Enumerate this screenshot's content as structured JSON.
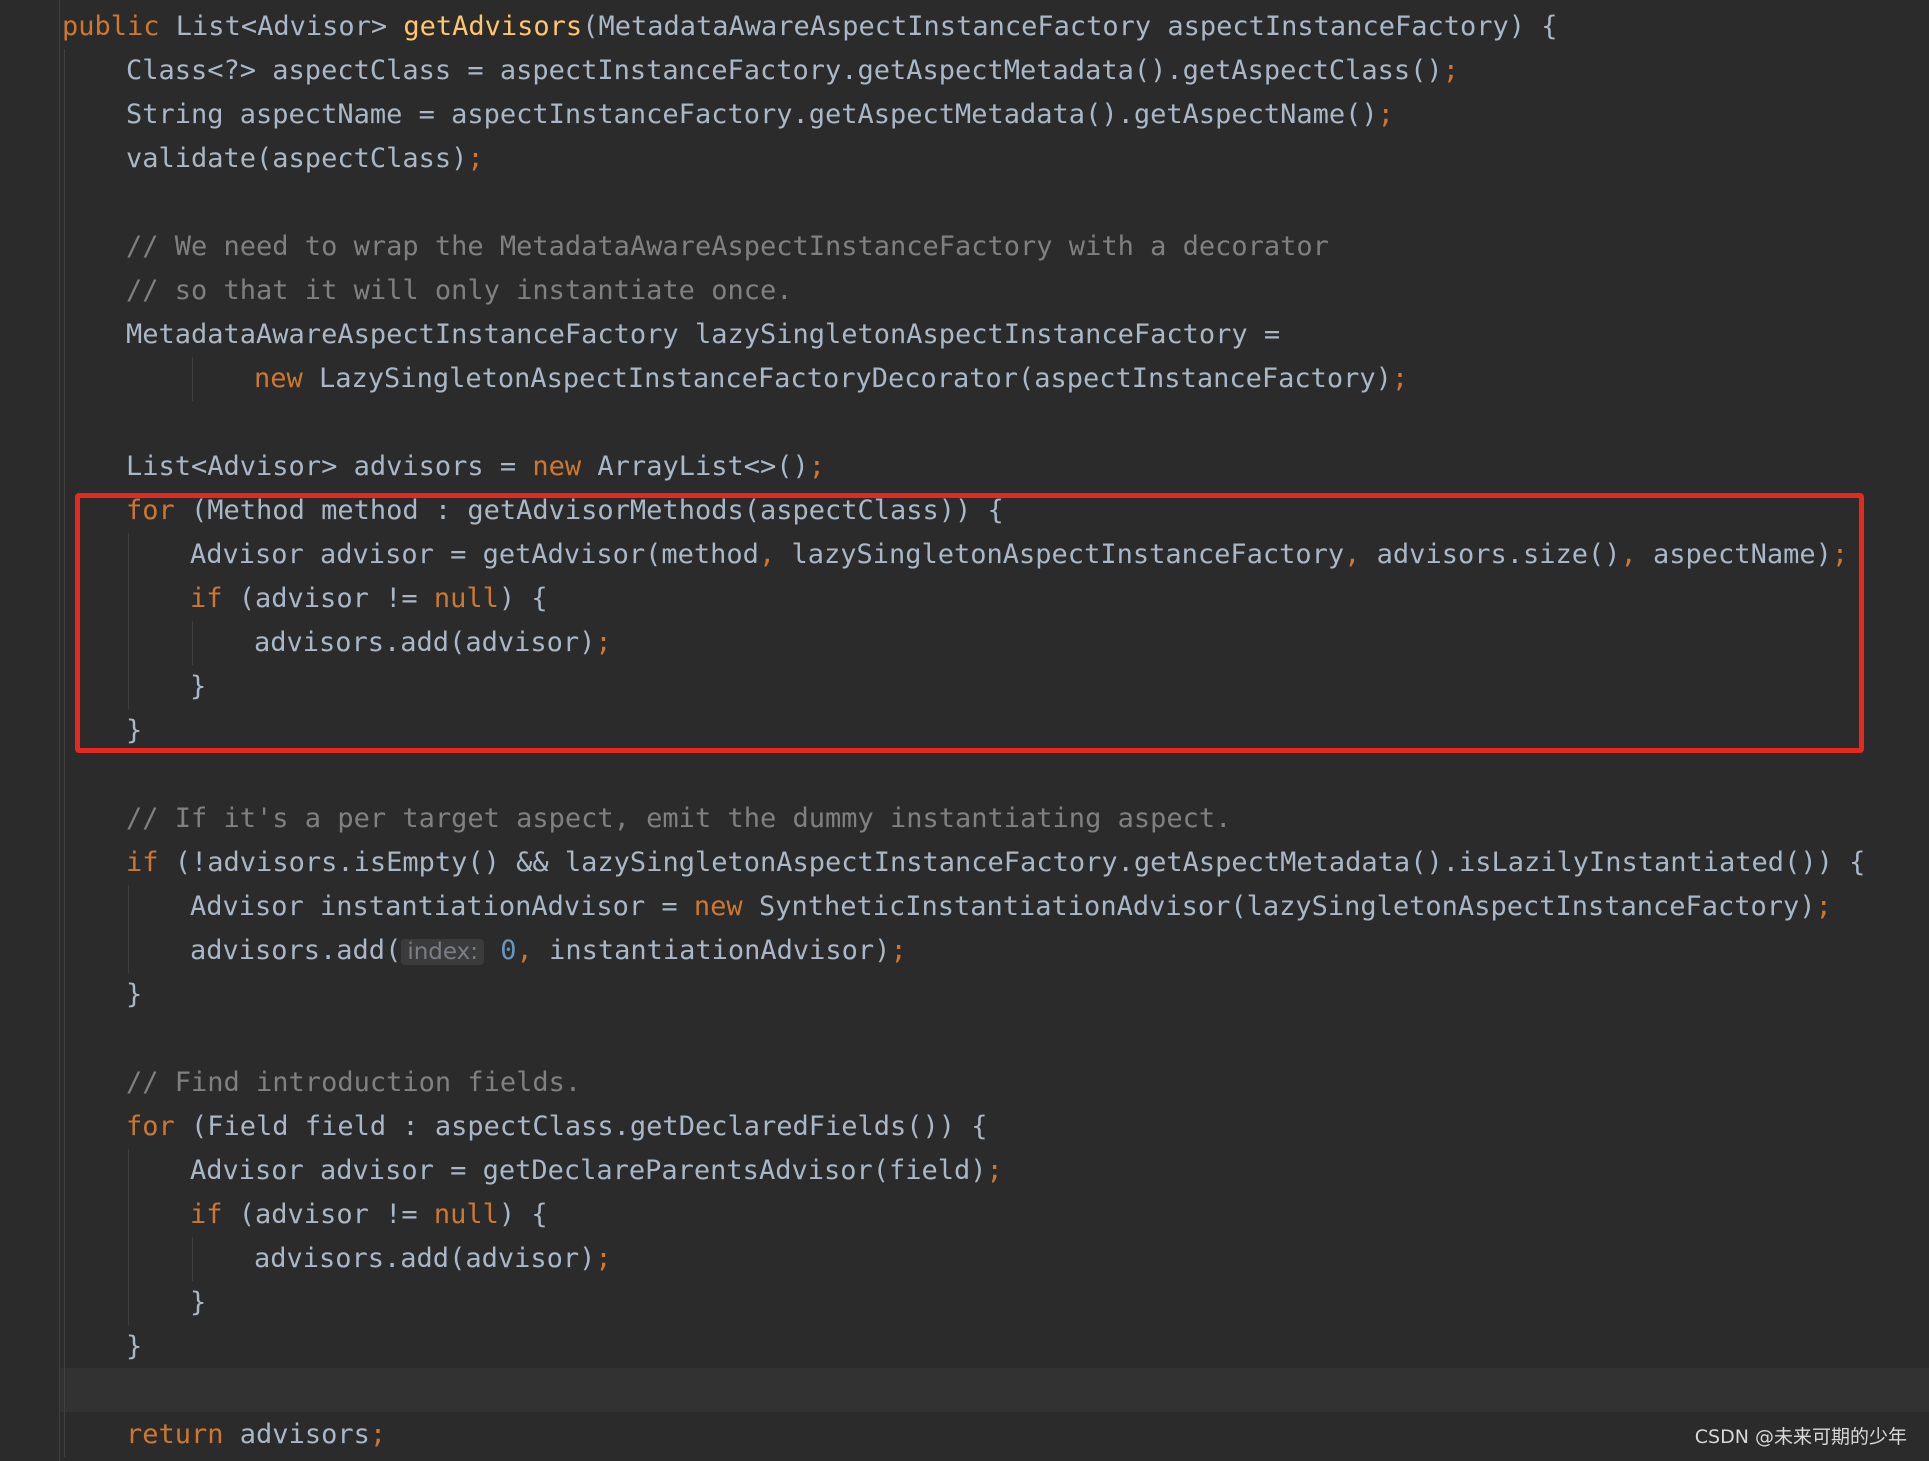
{
  "colors": {
    "background": "#2b2b2b",
    "plain": "#a9b7c6",
    "keyword": "#cc7832",
    "method_decl": "#ffc66d",
    "comment": "#808080",
    "number": "#6897bb",
    "hint": "#7a7e85",
    "highlight_box": "#e8271f"
  },
  "code_lines": [
    {
      "indent": 0,
      "tokens": [
        {
          "t": "kw",
          "v": "public "
        },
        {
          "t": "p",
          "v": "List<Advisor> "
        },
        {
          "t": "fn",
          "v": "getAdvisors"
        },
        {
          "t": "p",
          "v": "(MetadataAwareAspectInstanceFactory aspectInstanceFactory) {"
        }
      ]
    },
    {
      "indent": 1,
      "tokens": [
        {
          "t": "p",
          "v": "Class<?> aspectClass = aspectInstanceFactory.getAspectMetadata().getAspectClass()"
        },
        {
          "t": "kw",
          "v": ";"
        }
      ]
    },
    {
      "indent": 1,
      "tokens": [
        {
          "t": "p",
          "v": "String aspectName = aspectInstanceFactory.getAspectMetadata().getAspectName()"
        },
        {
          "t": "kw",
          "v": ";"
        }
      ]
    },
    {
      "indent": 1,
      "tokens": [
        {
          "t": "p",
          "v": "validate(aspectClass)"
        },
        {
          "t": "kw",
          "v": ";"
        }
      ]
    },
    {
      "indent": 0,
      "tokens": []
    },
    {
      "indent": 1,
      "tokens": [
        {
          "t": "cm",
          "v": "// We need to wrap the MetadataAwareAspectInstanceFactory with a decorator"
        }
      ]
    },
    {
      "indent": 1,
      "tokens": [
        {
          "t": "cm",
          "v": "// so that it will only instantiate once."
        }
      ]
    },
    {
      "indent": 1,
      "tokens": [
        {
          "t": "p",
          "v": "MetadataAwareAspectInstanceFactory lazySingletonAspectInstanceFactory ="
        }
      ]
    },
    {
      "indent": 3,
      "tokens": [
        {
          "t": "kw",
          "v": "new "
        },
        {
          "t": "p",
          "v": "LazySingletonAspectInstanceFactoryDecorator(aspectInstanceFactory)"
        },
        {
          "t": "kw",
          "v": ";"
        }
      ]
    },
    {
      "indent": 0,
      "tokens": []
    },
    {
      "indent": 1,
      "tokens": [
        {
          "t": "p",
          "v": "List<Advisor> advisors = "
        },
        {
          "t": "kw",
          "v": "new "
        },
        {
          "t": "p",
          "v": "ArrayList<>()"
        },
        {
          "t": "kw",
          "v": ";"
        }
      ]
    },
    {
      "indent": 1,
      "tokens": [
        {
          "t": "kw",
          "v": "for "
        },
        {
          "t": "p",
          "v": "(Method method : getAdvisorMethods(aspectClass)) {"
        }
      ]
    },
    {
      "indent": 2,
      "tokens": [
        {
          "t": "p",
          "v": "Advisor advisor = getAdvisor(method"
        },
        {
          "t": "kw",
          "v": ", "
        },
        {
          "t": "p",
          "v": "lazySingletonAspectInstanceFactory"
        },
        {
          "t": "kw",
          "v": ", "
        },
        {
          "t": "p",
          "v": "advisors.size()"
        },
        {
          "t": "kw",
          "v": ", "
        },
        {
          "t": "p",
          "v": "aspectName)"
        },
        {
          "t": "kw",
          "v": ";"
        }
      ]
    },
    {
      "indent": 2,
      "tokens": [
        {
          "t": "kw",
          "v": "if "
        },
        {
          "t": "p",
          "v": "(advisor != "
        },
        {
          "t": "kw",
          "v": "null"
        },
        {
          "t": "p",
          "v": ") {"
        }
      ]
    },
    {
      "indent": 3,
      "tokens": [
        {
          "t": "p",
          "v": "advisors.add(advisor)"
        },
        {
          "t": "kw",
          "v": ";"
        }
      ]
    },
    {
      "indent": 2,
      "tokens": [
        {
          "t": "p",
          "v": "}"
        }
      ]
    },
    {
      "indent": 1,
      "tokens": [
        {
          "t": "p",
          "v": "}"
        }
      ]
    },
    {
      "indent": 0,
      "tokens": []
    },
    {
      "indent": 1,
      "tokens": [
        {
          "t": "cm",
          "v": "// If it's a per target aspect, emit the dummy instantiating aspect."
        }
      ]
    },
    {
      "indent": 1,
      "tokens": [
        {
          "t": "kw",
          "v": "if "
        },
        {
          "t": "p",
          "v": "(!advisors.isEmpty() && lazySingletonAspectInstanceFactory.getAspectMetadata().isLazilyInstantiated()) {"
        }
      ]
    },
    {
      "indent": 2,
      "tokens": [
        {
          "t": "p",
          "v": "Advisor instantiationAdvisor = "
        },
        {
          "t": "kw",
          "v": "new "
        },
        {
          "t": "p",
          "v": "SyntheticInstantiationAdvisor(lazySingletonAspectInstanceFactory)"
        },
        {
          "t": "kw",
          "v": ";"
        }
      ]
    },
    {
      "indent": 2,
      "tokens": [
        {
          "t": "p",
          "v": "advisors.add("
        },
        {
          "t": "hint",
          "v": "index:"
        },
        {
          "t": "p",
          "v": " "
        },
        {
          "t": "num",
          "v": "0"
        },
        {
          "t": "kw",
          "v": ", "
        },
        {
          "t": "p",
          "v": "instantiationAdvisor)"
        },
        {
          "t": "kw",
          "v": ";"
        }
      ]
    },
    {
      "indent": 1,
      "tokens": [
        {
          "t": "p",
          "v": "}"
        }
      ]
    },
    {
      "indent": 0,
      "tokens": []
    },
    {
      "indent": 1,
      "tokens": [
        {
          "t": "cm",
          "v": "// Find introduction fields."
        }
      ]
    },
    {
      "indent": 1,
      "tokens": [
        {
          "t": "kw",
          "v": "for "
        },
        {
          "t": "p",
          "v": "(Field field : aspectClass.getDeclaredFields()) {"
        }
      ]
    },
    {
      "indent": 2,
      "tokens": [
        {
          "t": "p",
          "v": "Advisor advisor = getDeclareParentsAdvisor(field)"
        },
        {
          "t": "kw",
          "v": ";"
        }
      ]
    },
    {
      "indent": 2,
      "tokens": [
        {
          "t": "kw",
          "v": "if "
        },
        {
          "t": "p",
          "v": "(advisor != "
        },
        {
          "t": "kw",
          "v": "null"
        },
        {
          "t": "p",
          "v": ") {"
        }
      ]
    },
    {
      "indent": 3,
      "tokens": [
        {
          "t": "p",
          "v": "advisors.add(advisor)"
        },
        {
          "t": "kw",
          "v": ";"
        }
      ]
    },
    {
      "indent": 2,
      "tokens": [
        {
          "t": "p",
          "v": "}"
        }
      ]
    },
    {
      "indent": 1,
      "tokens": [
        {
          "t": "p",
          "v": "}"
        }
      ]
    },
    {
      "indent": 0,
      "tokens": []
    },
    {
      "indent": 1,
      "tokens": [
        {
          "t": "kw",
          "v": "return "
        },
        {
          "t": "p",
          "v": "advisors"
        },
        {
          "t": "kw",
          "v": ";"
        }
      ]
    }
  ],
  "watermark": "CSDN @未来可期的少年"
}
